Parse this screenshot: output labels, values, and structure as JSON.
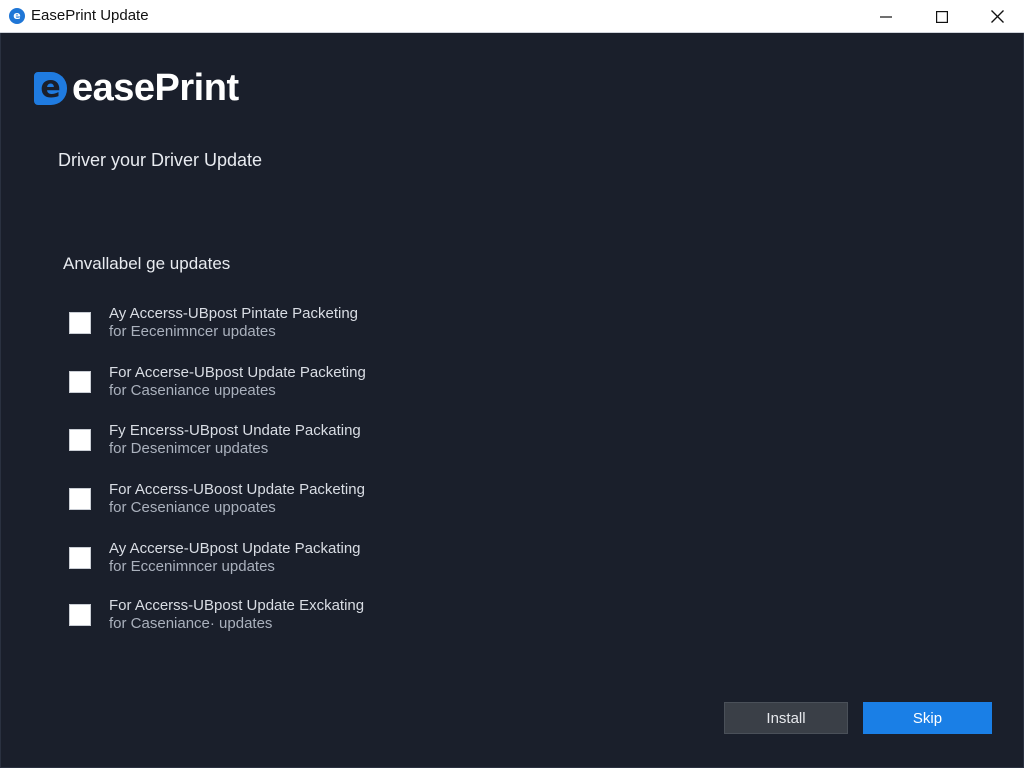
{
  "window": {
    "title": "EasePrint Update",
    "icon": "easeprint-app-icon",
    "controls": {
      "minimize_icon": "minimize-icon",
      "maximize_icon": "maximize-icon",
      "close_icon": "close-icon"
    }
  },
  "logo": {
    "mark": "e",
    "text": "easePrint"
  },
  "heading": "Driver your Driver Update",
  "section_title": "Anvallabel ge updates",
  "updates": [
    {
      "line1": "Ay Accerss-UBpost Pintate Packeting",
      "line2": "for Eecenimncer updates",
      "checked": false
    },
    {
      "line1": "For Accerse-UBpost Update Packeting",
      "line2": "for Caseniance uppeates",
      "checked": false
    },
    {
      "line1": "Fy Encerss-UBpost Undate Packating",
      "line2": "for Desenimcer updates",
      "checked": false
    },
    {
      "line1": "For Accerss-UBoost Update Packeting",
      "line2": "for Ceseniance uppoates",
      "checked": false
    },
    {
      "line1": "Ay Accerse-UBpost Update Packating",
      "line2": "for Eccenimncer updates",
      "checked": false
    },
    {
      "line1": "For Accerss-UBpost Update Exckating",
      "line2": "for Caseniance· updates",
      "checked": false
    }
  ],
  "buttons": {
    "install": "Install",
    "skip": "Skip"
  },
  "colors": {
    "background": "#1a1f2b",
    "accent": "#1a7fe6",
    "install_button": "#3a3f47"
  }
}
